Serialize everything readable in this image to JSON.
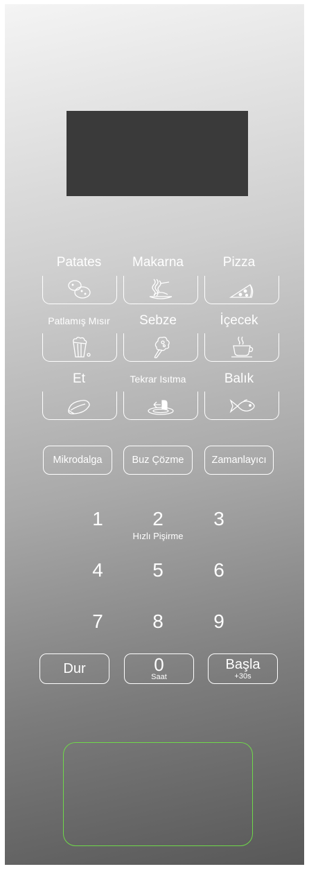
{
  "programs": [
    {
      "label": "Patates",
      "icon": "potato-icon"
    },
    {
      "label": "Makarna",
      "icon": "pasta-icon"
    },
    {
      "label": "Pizza",
      "icon": "pizza-icon"
    },
    {
      "label": "Patlamış Mısır",
      "icon": "popcorn-icon"
    },
    {
      "label": "Sebze",
      "icon": "vegetable-icon"
    },
    {
      "label": "İçecek",
      "icon": "cup-icon"
    },
    {
      "label": "Et",
      "icon": "meat-icon"
    },
    {
      "label": "Tekrar Isıtma",
      "icon": "reheat-plate-icon"
    },
    {
      "label": "Balık",
      "icon": "fish-icon"
    }
  ],
  "functions": {
    "microwave": "Mikrodalga",
    "defrost": "Buz Çözme",
    "timer": "Zamanlayıcı"
  },
  "keypad": {
    "keys": [
      "1",
      "2",
      "3",
      "4",
      "5",
      "6",
      "7",
      "8",
      "9"
    ],
    "quick_cook": "Hızlı Pişirme"
  },
  "controls": {
    "stop": "Dur",
    "zero": "0",
    "clock": "Saat",
    "start": "Başla",
    "start_sub": "+30s"
  },
  "colors": {
    "display": "#3a3a3a",
    "sensor_outline": "#6fd94a"
  }
}
